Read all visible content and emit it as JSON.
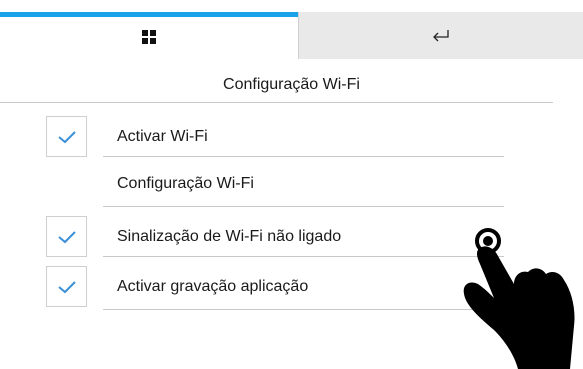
{
  "tabs": [
    {
      "id": "grid",
      "icon": "grid-icon",
      "active": true
    },
    {
      "id": "back",
      "icon": "return-arrow-icon",
      "active": false
    }
  ],
  "header": {
    "title": "Configuração Wi-Fi"
  },
  "rows": [
    {
      "label": "Activar Wi-Fi",
      "has_checkbox": true,
      "checked": true
    },
    {
      "label": "Configuração Wi-Fi",
      "has_checkbox": false,
      "checked": false
    },
    {
      "label": "Sinalização de Wi-Fi não ligado",
      "has_checkbox": true,
      "checked": true
    },
    {
      "label": "Activar gravação aplicação",
      "has_checkbox": true,
      "checked": true
    }
  ],
  "colors": {
    "accent": "#1aa3e8",
    "checkmark": "#3b8fd6",
    "inactive_tab": "#e9e9e9",
    "divider": "#c9c9c9"
  },
  "overlay": {
    "icon": "tap-hand-pointer-icon"
  }
}
